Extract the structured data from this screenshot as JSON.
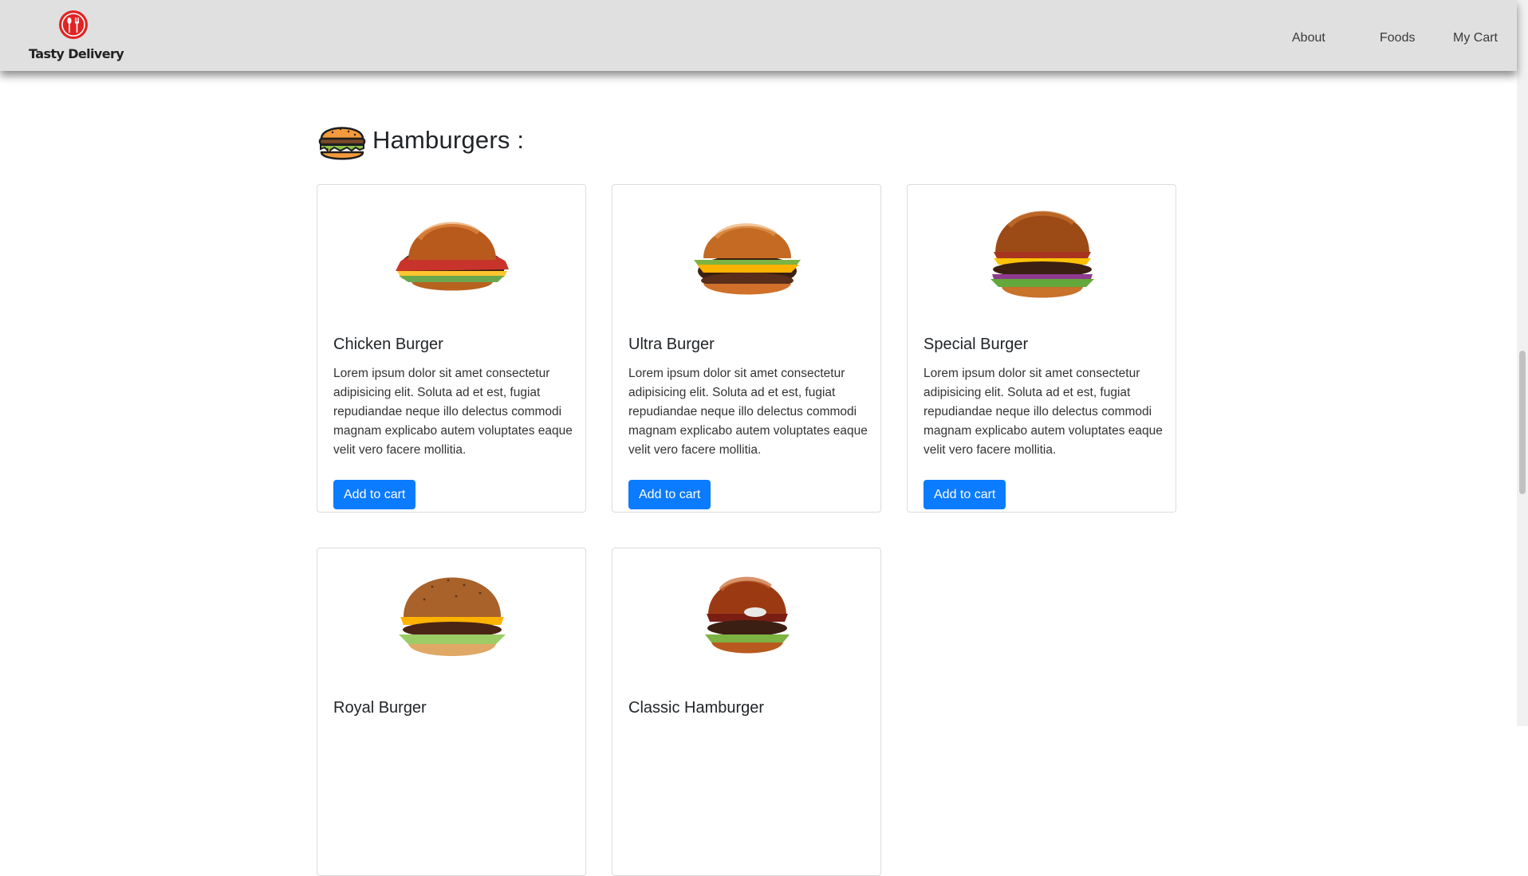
{
  "brand": {
    "name": "Tasty Delivery",
    "logo_icon": "fork-spoon-plate-icon",
    "accent": "#e02424"
  },
  "nav": {
    "about": "About",
    "foods": "Foods",
    "cart": "My Cart"
  },
  "section": {
    "title": "Hamburgers :",
    "icon": "hamburger-icon"
  },
  "colors": {
    "button": "#0b7bff",
    "navbar": "#e0e0e0"
  },
  "products": [
    {
      "title": "Chicken Burger",
      "description": "Lorem ipsum dolor sit amet consectetur adipisicing elit. Soluta ad et est, fugiat repudiandae neque illo delectus commodi magnam explicabo autem voluptates eaque velit vero facere mollitia.",
      "button": "Add to cart"
    },
    {
      "title": "Ultra Burger",
      "description": "Lorem ipsum dolor sit amet consectetur adipisicing elit. Soluta ad et est, fugiat repudiandae neque illo delectus commodi magnam explicabo autem voluptates eaque velit vero facere mollitia.",
      "button": "Add to cart"
    },
    {
      "title": "Special Burger",
      "description": "Lorem ipsum dolor sit amet consectetur adipisicing elit. Soluta ad et est, fugiat repudiandae neque illo delectus commodi magnam explicabo autem voluptates eaque velit vero facere mollitia.",
      "button": "Add to cart"
    },
    {
      "title": "Royal Burger"
    },
    {
      "title": "Classic Hamburger"
    }
  ]
}
